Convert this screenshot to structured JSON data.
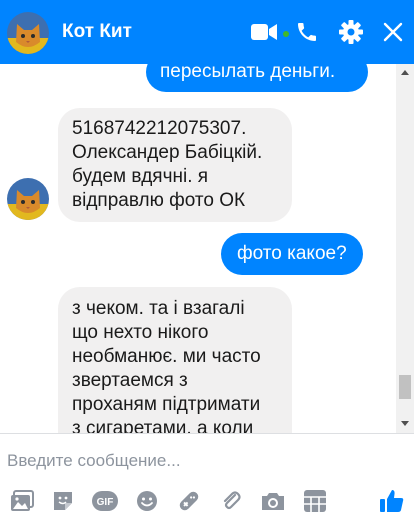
{
  "header": {
    "title": "Кот Кит",
    "accent": "#0084ff",
    "online_color": "#42b72a"
  },
  "messages": [
    {
      "direction": "out",
      "text": "пересылать деньги."
    },
    {
      "direction": "in",
      "text": "5168742212075307.\nОлександер Бабіцкій.\nбудем вдячні. я\nвідправлю фото ОК"
    },
    {
      "direction": "out",
      "text": "фото какое?"
    },
    {
      "direction": "in",
      "text": "з чеком. та і взагалі\nщо нехто нікого\nнеобманює. ми часто\nзвертаемся з\nпроханям підтримати\nз сигаретами, а коли"
    }
  ],
  "composer": {
    "placeholder": "Введите сообщение..."
  },
  "icons": {
    "header": [
      "video-camera-icon",
      "phone-icon",
      "gear-icon",
      "close-icon"
    ],
    "toolbar": [
      "photo-icon",
      "sticker-icon",
      "gif-icon",
      "emoji-icon",
      "game-icon",
      "attachment-icon",
      "camera-icon",
      "poll-icon",
      "like-icon"
    ]
  }
}
